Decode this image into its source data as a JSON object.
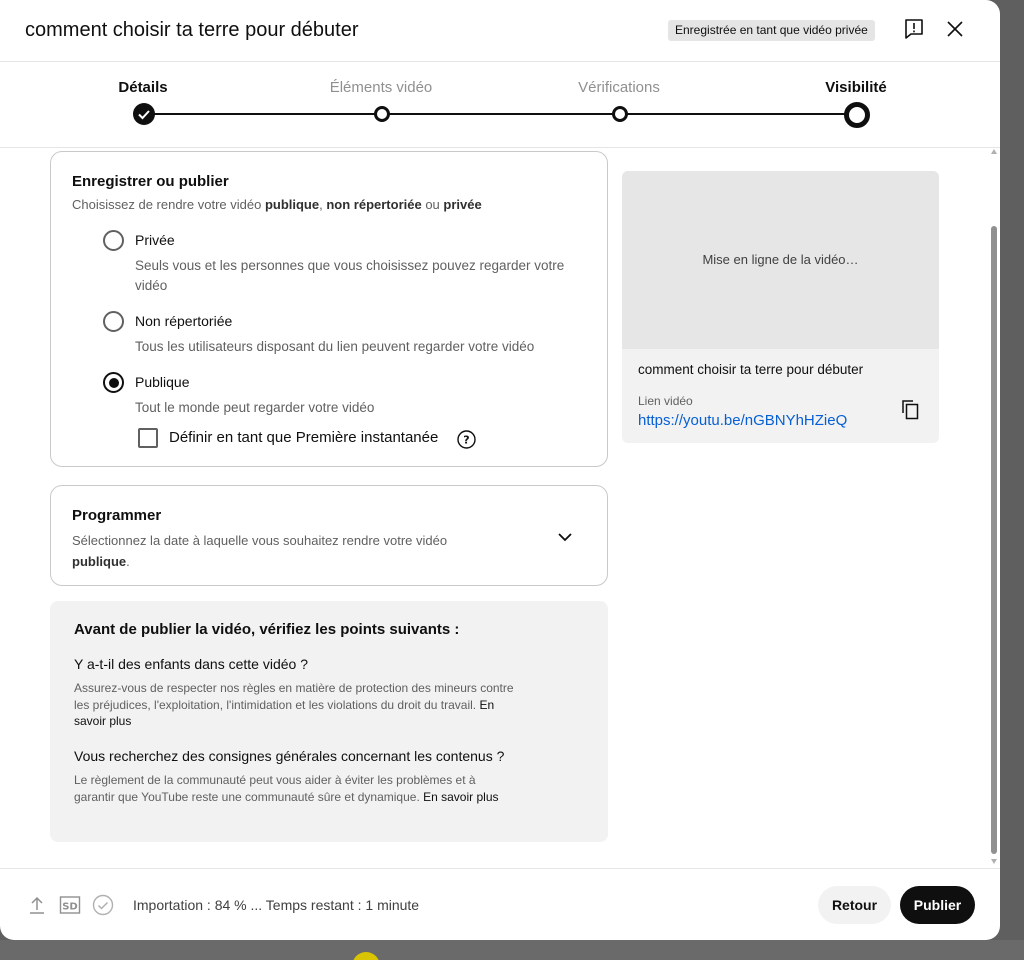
{
  "header": {
    "title": "comment choisir ta terre pour débuter",
    "saved_badge": "Enregistrée en tant que vidéo privée",
    "icons": {
      "feedback": "feedback-icon",
      "close": "close-icon"
    }
  },
  "stepper": {
    "steps": [
      {
        "label": "Détails",
        "state": "done"
      },
      {
        "label": "Éléments vidéo",
        "state": "todo"
      },
      {
        "label": "Vérifications",
        "state": "todo"
      },
      {
        "label": "Visibilité",
        "state": "active"
      }
    ]
  },
  "save_card": {
    "title": "Enregistrer ou publier",
    "subtitle_prefix": "Choisissez de rendre votre vidéo ",
    "subtitle_public": "publique",
    "subtitle_sep": ", ",
    "subtitle_unlisted": "non répertoriée",
    "subtitle_or": " ou ",
    "subtitle_private": "privée",
    "options": [
      {
        "label": "Privée",
        "desc": "Seuls vous et les personnes que vous choisissez pouvez regarder votre vidéo",
        "checked": false
      },
      {
        "label": "Non répertoriée",
        "desc": "Tous les utilisateurs disposant du lien peuvent regarder votre vidéo",
        "checked": false
      },
      {
        "label": "Publique",
        "desc": "Tout le monde peut regarder votre vidéo",
        "checked": true
      }
    ],
    "premiere_label": "Définir en tant que Première instantanée",
    "premiere_checked": false
  },
  "schedule_card": {
    "title": "Programmer",
    "subtitle": "Sélectionnez la date à laquelle vous souhaitez rendre votre vidéo",
    "subtitle_bold": "publique",
    "subtitle_end": "."
  },
  "checks": {
    "title": "Avant de publier la vidéo, vérifiez les points suivants :",
    "q1": "Y a-t-il des enfants dans cette vidéo ?",
    "t1": "Assurez-vous de respecter nos règles en matière de protection des mineurs contre les préjudices, l'exploitation, l'intimidation et les violations du droit du travail.",
    "l1": "En savoir plus",
    "q2": "Vous recherchez des consignes générales concernant les contenus ?",
    "t2": "Le règlement de la communauté peut vous aider à éviter les problèmes et à garantir que YouTube reste une communauté sûre et dynamique.",
    "l2": "En savoir plus"
  },
  "preview": {
    "uploading_msg": "Mise en ligne de la vidéo…",
    "video_title": "comment choisir ta terre pour débuter",
    "link_label": "Lien vidéo",
    "link_url": "https://youtu.be/nGBNYhHZieQ"
  },
  "footer": {
    "status": "Importation : 84 % ... Temps restant : 1 minute",
    "sd_label": "SD",
    "back_label": "Retour",
    "publish_label": "Publier"
  },
  "colors": {
    "link": "#065fd4",
    "primary_button": "#0f0f0f"
  }
}
